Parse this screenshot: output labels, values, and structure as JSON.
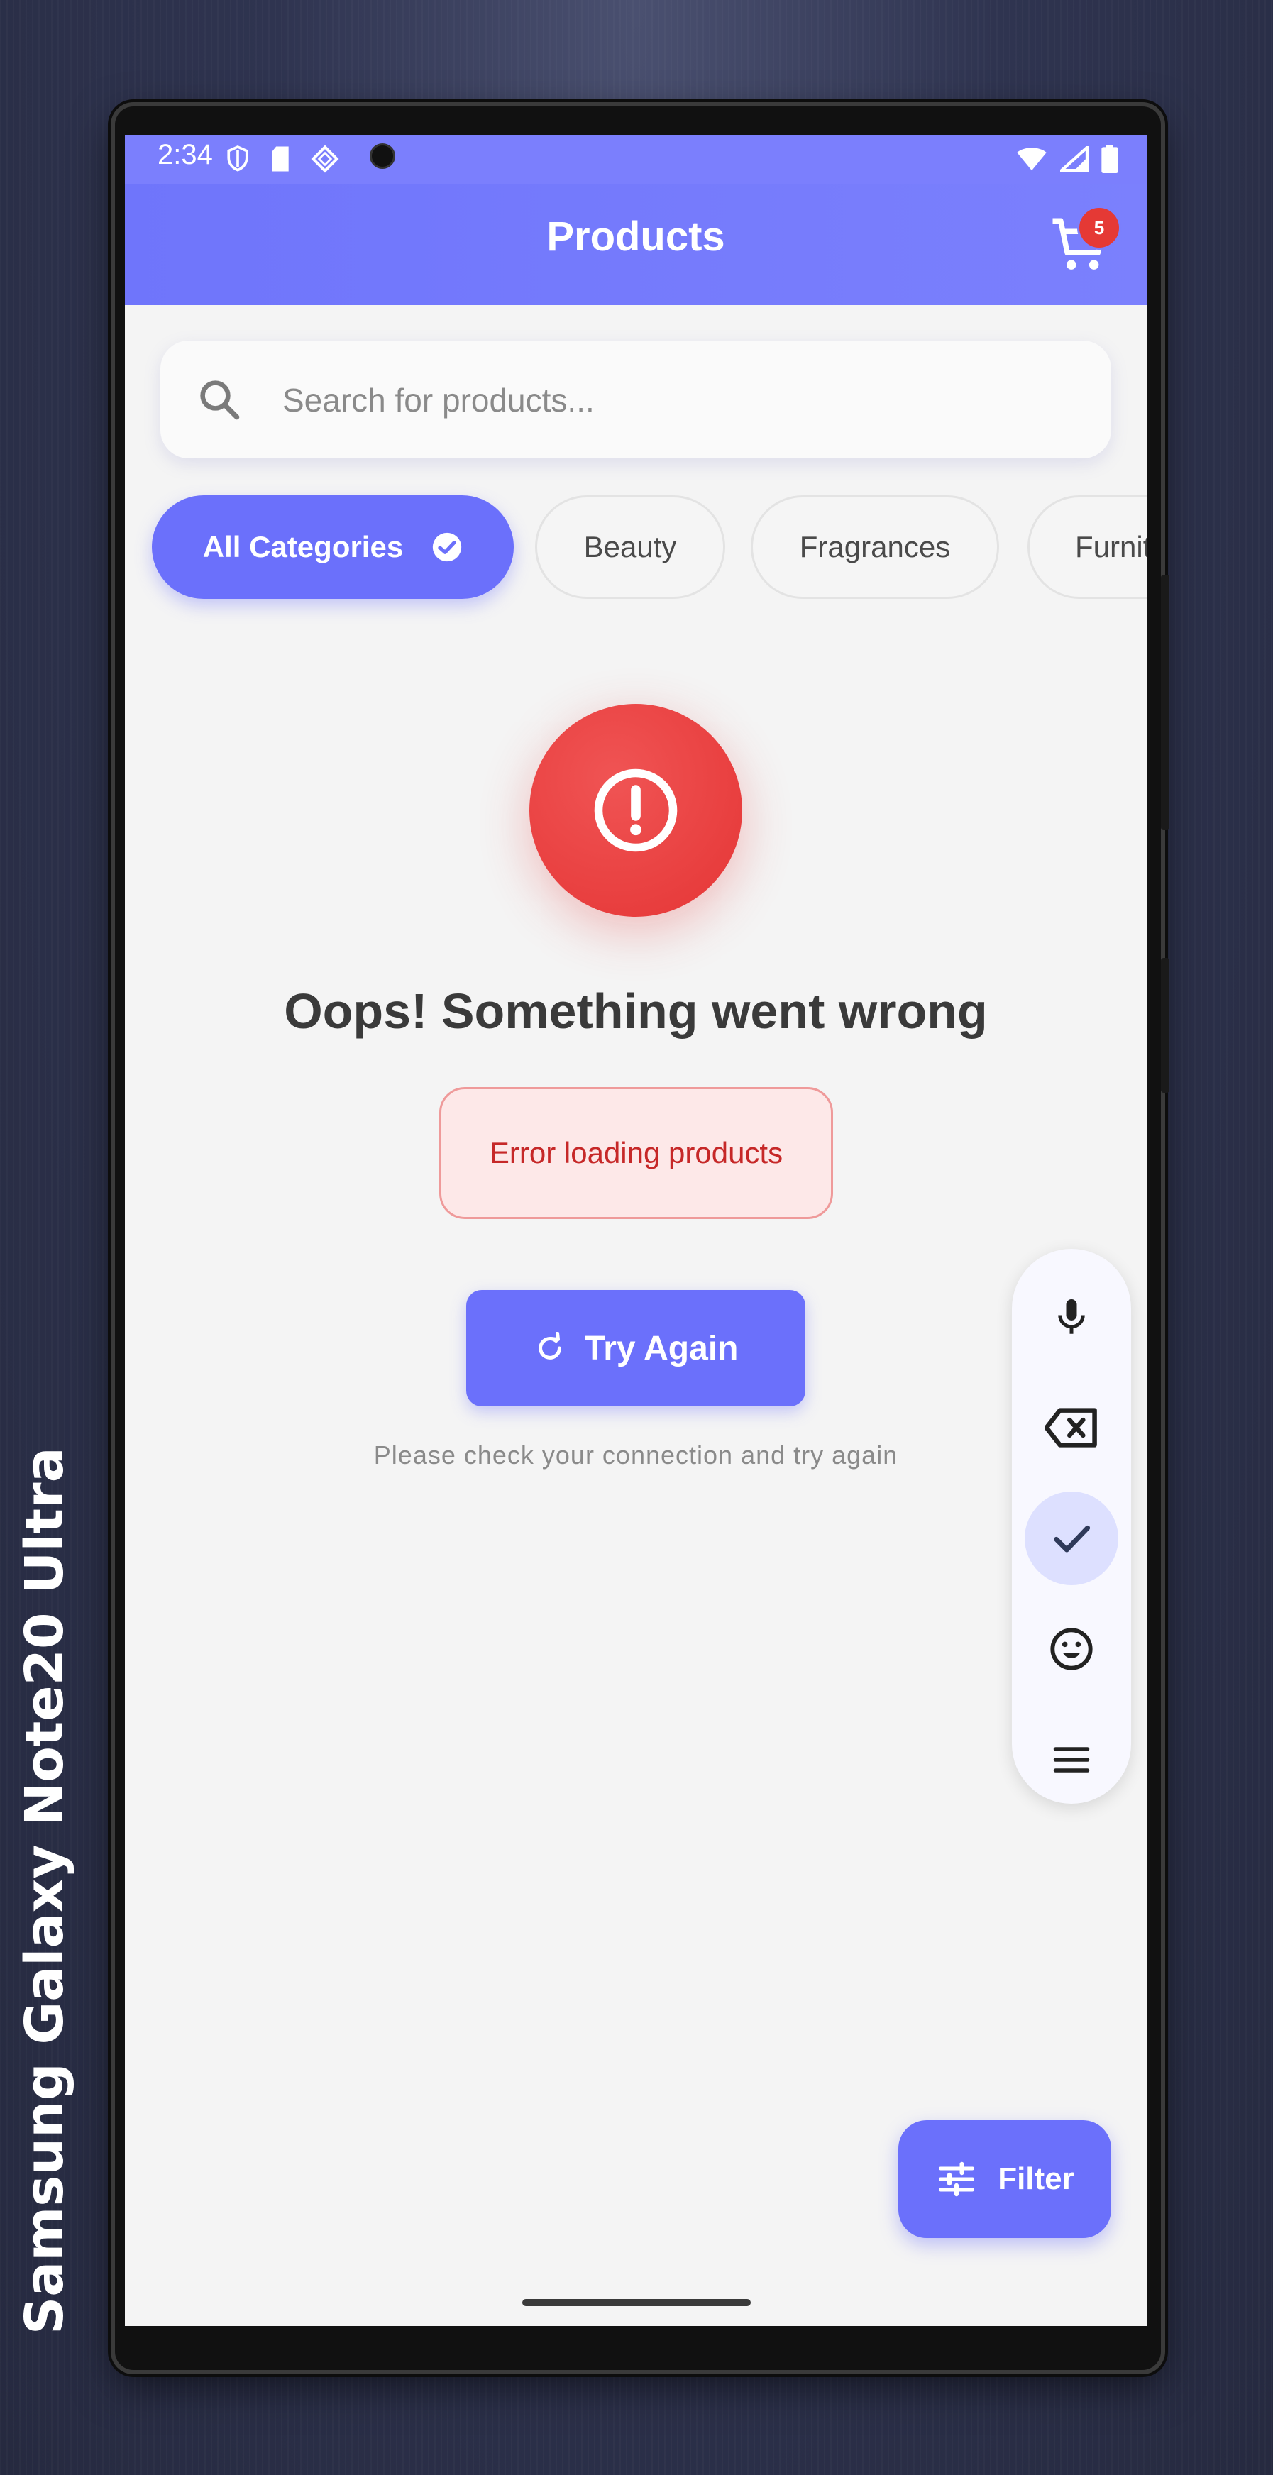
{
  "device_label": "Samsung Galaxy  Note20 Ultra",
  "status": {
    "time": "2:34"
  },
  "appbar": {
    "title": "Products",
    "cart_count": "5"
  },
  "search": {
    "placeholder": "Search for products..."
  },
  "categories": [
    {
      "label": "All Categories",
      "selected": true
    },
    {
      "label": "Beauty"
    },
    {
      "label": "Fragrances"
    },
    {
      "label": "Furnit"
    }
  ],
  "error": {
    "title": "Oops! Something went wrong",
    "message": "Error loading products",
    "retry_label": "Try Again",
    "hint": "Please check your connection and try again"
  },
  "filter": {
    "label": "Filter"
  },
  "colors": {
    "accent": "#6b70fb",
    "appbar": "#7b7ffd",
    "error": "#e53935"
  },
  "toolbar": {
    "icons": [
      "mic-icon",
      "backspace-icon",
      "check-icon",
      "emoji-icon",
      "menu-icon"
    ],
    "active": "check-icon"
  }
}
